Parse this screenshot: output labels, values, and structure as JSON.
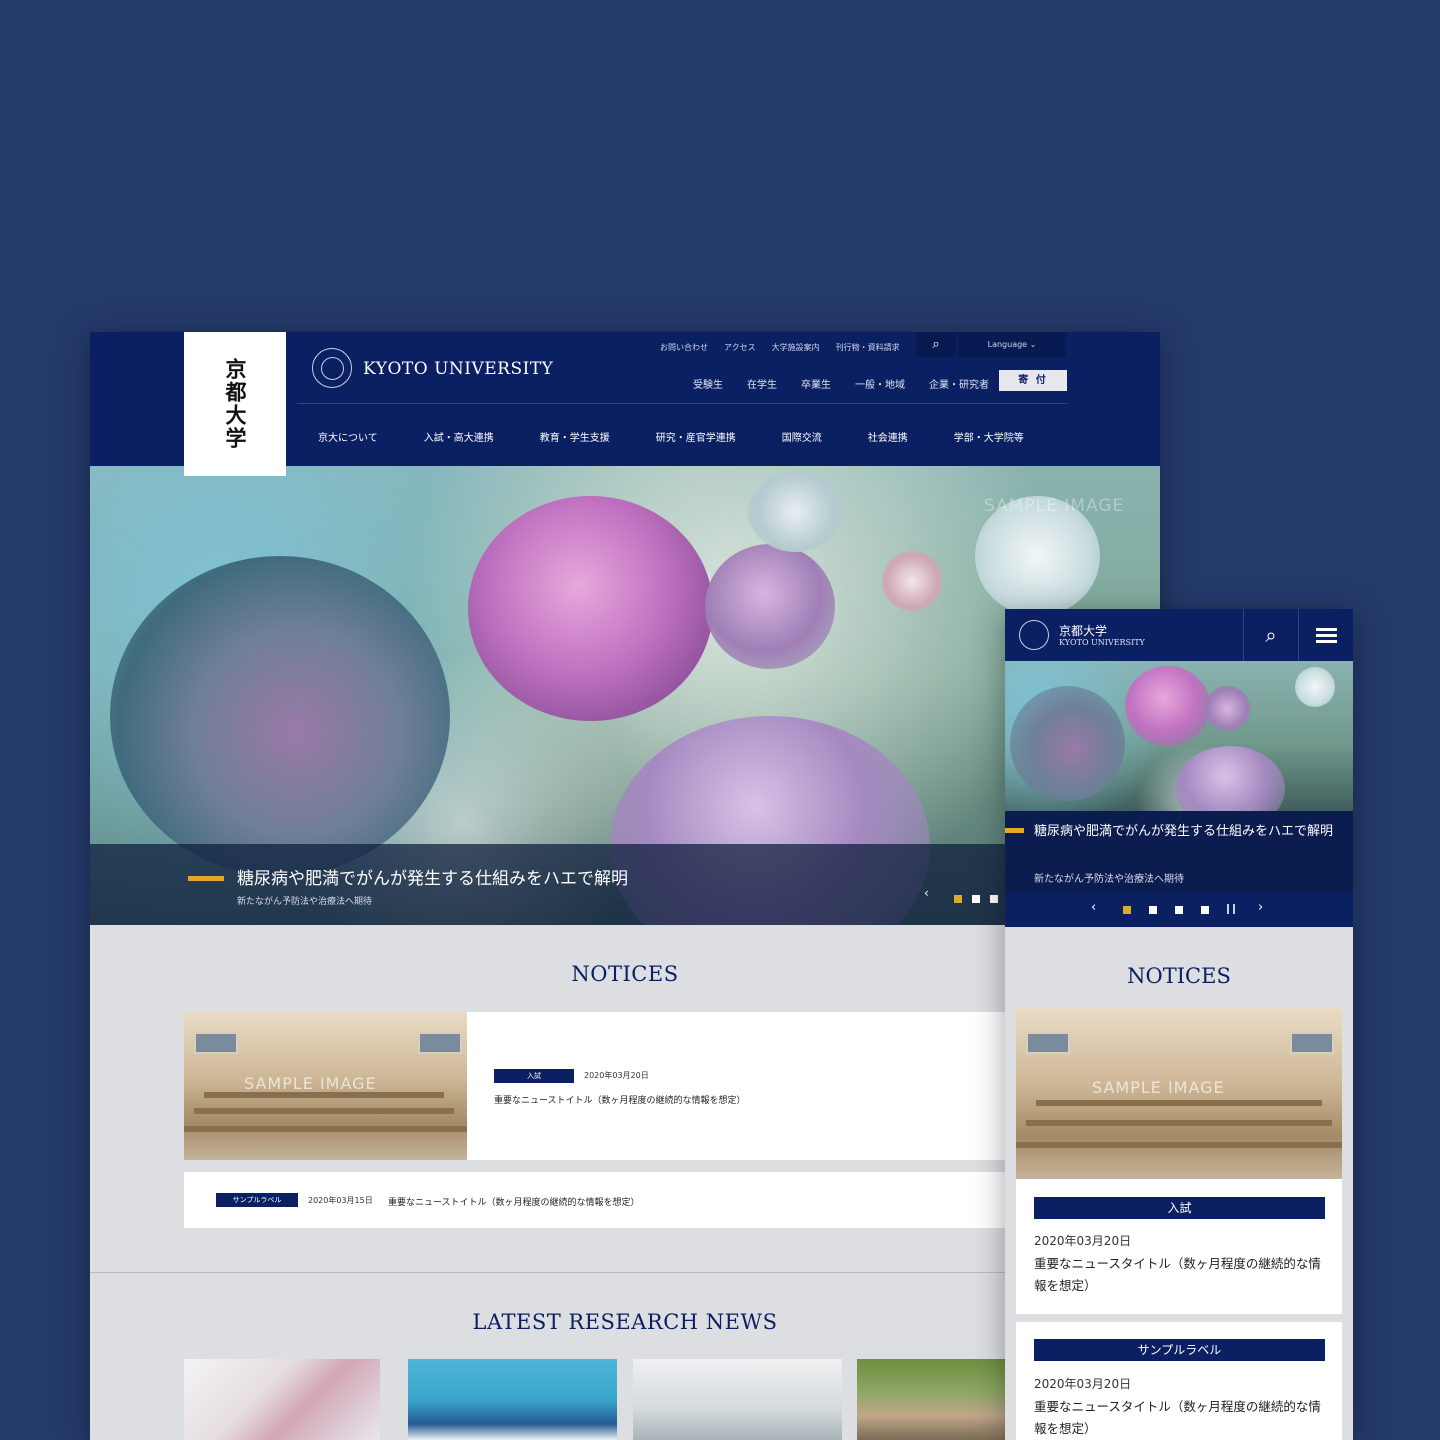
{
  "desktop": {
    "logo_ja": "京都大学",
    "brand": "KYOTO UNIVERSITY",
    "util_links": [
      "お問い合わせ",
      "アクセス",
      "大学施設案内",
      "刊行物・資料請求"
    ],
    "search_icon": "⌕",
    "language": "Language ⌄",
    "audience_links": [
      "受験生",
      "在学生",
      "卒業生",
      "一般・地域",
      "企業・研究者"
    ],
    "donate": "寄 付",
    "nav": [
      "京大について",
      "入試・高大連携",
      "教育・学生支援",
      "研究・産官学連携",
      "国際交流",
      "社会連携",
      "学部・大学院等"
    ],
    "hero": {
      "sample": "SAMPLE IMAGE",
      "title": "糖尿病や肥満でがんが発生する仕組みをハエで解明",
      "subtitle": "新たながん予防法や治療法へ期待",
      "prev": "‹"
    },
    "notices_title": "NOTICES",
    "notices": [
      {
        "tag": "入試",
        "date": "2020年03月20日",
        "title": "重要なニューストイトル（数ヶ月程度の継続的な情報を想定）",
        "sample": "SAMPLE IMAGE"
      },
      {
        "tag": "サンプルラベル",
        "date": "2020年03月15日",
        "title": "重要なニューストイトル（数ヶ月程度の継続的な情報を想定）"
      }
    ],
    "research_title": "LATEST RESEARCH NEWS"
  },
  "mobile": {
    "name_ja": "京都大学",
    "name_en": "KYOTO UNIVERSITY",
    "search_icon": "⌕",
    "hero": {
      "title": "糖尿病や肥満でがんが発生する仕組みをハエで解明",
      "subtitle": "新たながん予防法や治療法へ期待",
      "prev": "‹",
      "next": "›"
    },
    "notices_title": "NOTICES",
    "notices": [
      {
        "tag": "入試",
        "date": "2020年03月20日",
        "title": "重要なニュースタイトル（数ヶ月程度の継続的な情報を想定）",
        "sample": "SAMPLE IMAGE"
      },
      {
        "tag": "サンプルラベル",
        "date": "2020年03月20日",
        "title": "重要なニュースタイトル（数ヶ月程度の継続的な情報を想定）"
      }
    ]
  },
  "colors": {
    "background": "#243a6b",
    "brand_navy": "#0b2063",
    "accent_gold": "#e5a72a",
    "page_gray": "#dcdee2"
  }
}
